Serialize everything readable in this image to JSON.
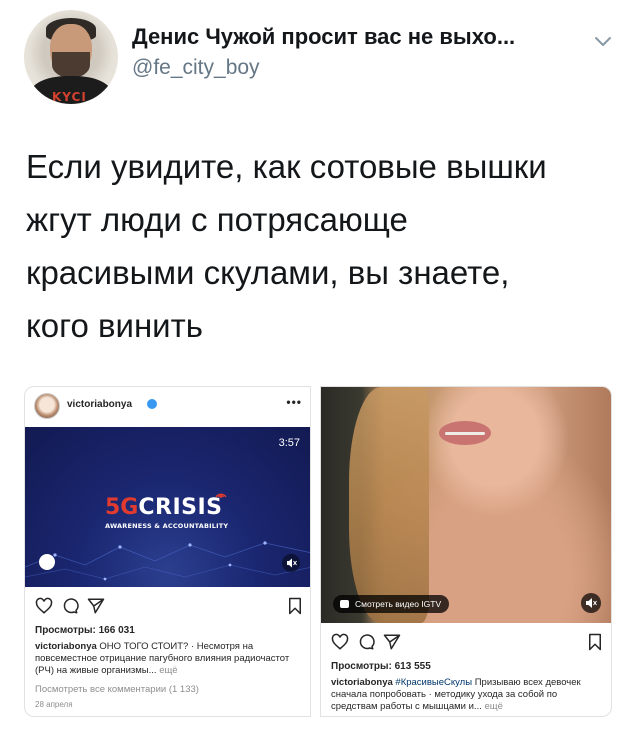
{
  "tweet": {
    "display_name": "Денис Чужой просит вас не выхо...",
    "handle": "@fe_city_boy",
    "avatar_shirt_text": "KYCI",
    "text": "Если увидите, как сотовые вышки\nжгут люди с потрясающе\nкрасивыми скулами, вы знаете,\nкого винить"
  },
  "left_post": {
    "username": "victoriabonya",
    "more": "•••",
    "video_time": "3:57",
    "logo_five": "5G",
    "logo_crisis": "CRISIS",
    "logo_sub": "AWARENESS & ACCOUNTABILITY",
    "views": "Просмотры: 166 031",
    "caption_user": "victoriabonya",
    "caption_text": " ОНО ТОГО СТОИТ? · Несмотря на повсеместное отрицание пагубного влияния радиочастот (РЧ) на живые организмы...",
    "caption_more": " ещё",
    "comments_link": "Посмотреть все комментарии (1 133)",
    "date": "28 апреля"
  },
  "right_post": {
    "igtv_label": "Смотреть видео IGTV",
    "views": "Просмотры: 613 555",
    "caption_user": "victoriabonya",
    "caption_hashtag": " #КрасивыеСкулы",
    "caption_text": " Призываю всех девочек сначала попробовать · методику ухода за собой по средствам работы с мышцами и...",
    "caption_more": " ещё"
  },
  "colors": {
    "twitter_text": "#14171a",
    "twitter_secondary": "#657786",
    "instagram_text": "#262626",
    "instagram_muted": "#8e8e8e",
    "verified_blue": "#3897f0",
    "crisis_red": "#e03b2e",
    "video_bg": "#1a2670"
  }
}
